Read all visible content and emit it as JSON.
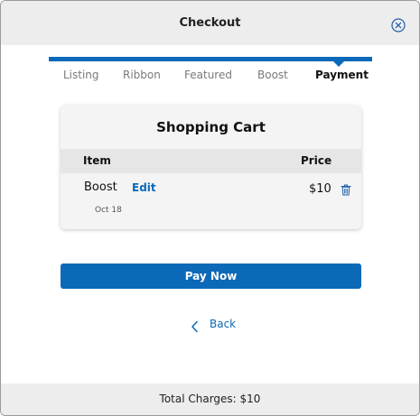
{
  "header": {
    "title": "Checkout"
  },
  "steps": [
    {
      "label": "Listing"
    },
    {
      "label": "Ribbon"
    },
    {
      "label": "Featured"
    },
    {
      "label": "Boost"
    },
    {
      "label": "Payment",
      "active": true
    }
  ],
  "cart": {
    "title": "Shopping Cart",
    "columns": {
      "item": "Item",
      "price": "Price"
    },
    "items": [
      {
        "name": "Boost",
        "edit_label": "Edit",
        "price": "$10",
        "date": "Oct 18"
      }
    ]
  },
  "actions": {
    "pay_label": "Pay Now",
    "back_label": "Back"
  },
  "footer": {
    "total_text": "Total Charges: $10"
  },
  "colors": {
    "accent": "#0b69b8",
    "header_bg": "#ededed",
    "card_bg": "#f4f4f4"
  },
  "icons": {
    "close": "close-circle-icon",
    "trash": "trash-icon",
    "back": "chevron-left-icon"
  }
}
